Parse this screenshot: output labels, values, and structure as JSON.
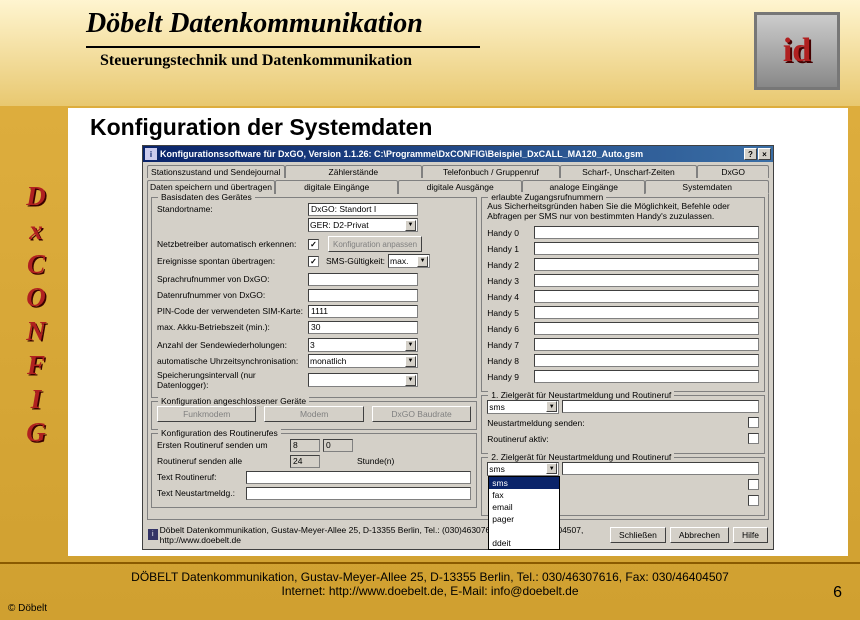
{
  "header": {
    "title": "Döbelt Datenkommunikation",
    "subtitle": "Steuerungstechnik und Datenkommunikation",
    "logo_text": "id"
  },
  "vlabel": [
    "D",
    "x",
    "C",
    "O",
    "N",
    "F",
    "I",
    "G"
  ],
  "page_title": "Konfiguration der Systemdaten",
  "window": {
    "title": "Konfigurationssoftware für DxGO, Version 1.1.26:    C:\\Programme\\DxCONFIG\\Beispiel_DxCALL_MA120_Auto.gsm",
    "help_btn": "?",
    "close_btn": "×",
    "tabs_row1": [
      "Stationszustand und Sendejournal",
      "Zählerstände",
      "Telefonbuch / Gruppenruf",
      "Scharf-, Unscharf-Zeiten",
      "DxGO"
    ],
    "tabs_row2": [
      "Daten speichern und übertragen",
      "digitale Eingänge",
      "digitale Ausgänge",
      "analoge Eingänge",
      "Systemdaten"
    ],
    "active_tab": "Systemdaten",
    "group_basis": {
      "legend": "Basisdaten des Gerätes",
      "standortname_lbl": "Standortname:",
      "standortname_val": "DxGO: Standort I",
      "netz_sel_val": "GER: D2-Privat",
      "netz_auto_lbl": "Netzbetreiber automatisch erkennen:",
      "netz_auto_checked": "✓",
      "konfig_anpassen_btn": "Konfiguration anpassen",
      "ereignisse_lbl": "Ereignisse spontan übertragen:",
      "ereignisse_checked": "✓",
      "sms_gueltigkeit_lbl": "SMS-Gültigkeit:",
      "sms_gueltigkeit_val": "max.",
      "sprachruf_lbl": "Sprachrufnummer von DxGO:",
      "sprachruf_val": "",
      "datenruf_lbl": "Datenrufnummer  von DxGO:",
      "datenruf_val": "",
      "pin_lbl": "PIN-Code der verwendeten SIM-Karte:",
      "pin_val": "1111",
      "akku_lbl": "max. Akku-Betriebszeit (min.):",
      "akku_val": "30",
      "sendewdh_lbl": "Anzahl der Sendewiederholungen:",
      "sendewdh_val": "3",
      "uhrzeit_lbl": "automatische Uhrzeitsynchronisation:",
      "uhrzeit_val": "monatlich",
      "speicher_lbl": "Speicherungsintervall (nur Datenlogger):",
      "speicher_val": ""
    },
    "group_geraete": {
      "legend": "Konfiguration angeschlossener Geräte",
      "funkmodem_btn": "Funkmodem",
      "modem_btn": "Modem",
      "baudrate_btn": "DxGO Baudrate"
    },
    "group_routine": {
      "legend": "Konfiguration des Routinerufes",
      "ersten_lbl": "Ersten Routineruf senden um",
      "ersten_h": "8",
      "ersten_m": "0",
      "alle_lbl": "Routineruf senden alle",
      "alle_val": "24",
      "stunden_lbl": "Stunde(n)",
      "text_routine_lbl": "Text Routineruf:",
      "text_routine_val": "",
      "text_neustart_lbl": "Text Neustartmeldg.:",
      "text_neustart_val": ""
    },
    "group_handys": {
      "legend": "erlaubte Zugangsrufnummern",
      "note": "Aus Sicherheitsgründen haben Sie die Möglichkeit, Befehle oder Abfragen per SMS nur von bestimmten Handy's zuzulassen.",
      "items": [
        "Handy 0",
        "Handy 1",
        "Handy 2",
        "Handy 3",
        "Handy 4",
        "Handy 5",
        "Handy 6",
        "Handy 7",
        "Handy 8",
        "Handy 9"
      ]
    },
    "group_ziel1": {
      "legend": "1. Zielgerät für Neustartmeldung und Routineruf",
      "sel_val": "sms",
      "neustart_lbl": "Neustartmeldung senden:",
      "routine_lbl": "Routineruf aktiv:"
    },
    "group_ziel2": {
      "legend": "2. Zielgerät für Neustartmeldung und Routineruf",
      "sel_val": "sms",
      "dropdown": [
        "sms",
        "fax",
        "email",
        "pager",
        "",
        "ddeit"
      ],
      "input_val": ""
    },
    "status": "Döbelt Datenkommunikation, Gustav-Meyer-Allee 25, D-13355 Berlin, Tel.: (030)46307616, Fax: (030)46404507, http://www.doebelt.de",
    "buttons": {
      "close": "Schließen",
      "cancel": "Abbrechen",
      "help": "Hilfe"
    }
  },
  "footer": {
    "line1": "DÖBELT Datenkommunikation, Gustav-Meyer-Allee 25, D-13355 Berlin, Tel.: 030/46307616, Fax: 030/46404507",
    "line2": "Internet: http://www.doebelt.de, E-Mail: info@doebelt.de",
    "copyright": "© Döbelt",
    "pagenum": "6"
  }
}
